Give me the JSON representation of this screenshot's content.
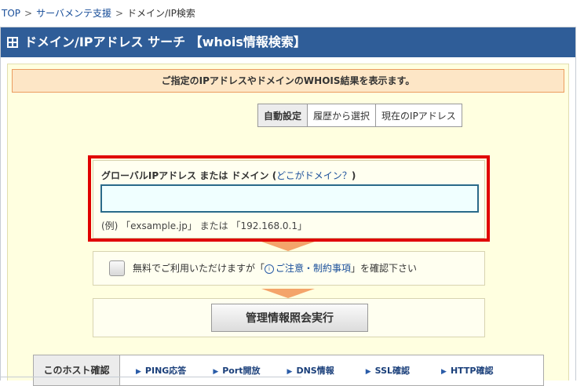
{
  "breadcrumb": {
    "items": [
      "TOP",
      "サーバメンテ支援",
      "ドメイン/IP検索"
    ],
    "separator": ">"
  },
  "header": {
    "title": "ドメイン/IPアドレス サーチ 【whois情報検索】",
    "icon": "grid-icon"
  },
  "notice": {
    "text": "ご指定のIPアドレスやドメインのWHOIS結果を表示ます。"
  },
  "tabs": [
    {
      "label": "自動設定",
      "active": true
    },
    {
      "label": "履歴から選択",
      "active": false
    },
    {
      "label": "現在のIPアドレス",
      "active": false
    }
  ],
  "search": {
    "label": "グローバルIPアドレス または ドメイン",
    "paren_open": "(",
    "help_link": "どこがドメイン？",
    "paren_close": ")",
    "value": "",
    "placeholder": "",
    "example": "(例) 「exsample.jp」 または 「192.168.0.1」"
  },
  "agree": {
    "text_before": "無料でご利用いただけますが「",
    "link": "ご注意・制約事項",
    "text_after": "」を確認下さい",
    "checked": false
  },
  "execute": {
    "label": "管理情報照会実行"
  },
  "host_check": {
    "label": "このホスト確認",
    "links": [
      "PING応答",
      "Port開放",
      "DNS情報",
      "SSL確認",
      "HTTP確認"
    ]
  },
  "colors": {
    "header_bg": "#2f5d98",
    "body_bg": "#ffffe0",
    "highlight": "#e00000",
    "notice_bg": "#fde6c6"
  }
}
